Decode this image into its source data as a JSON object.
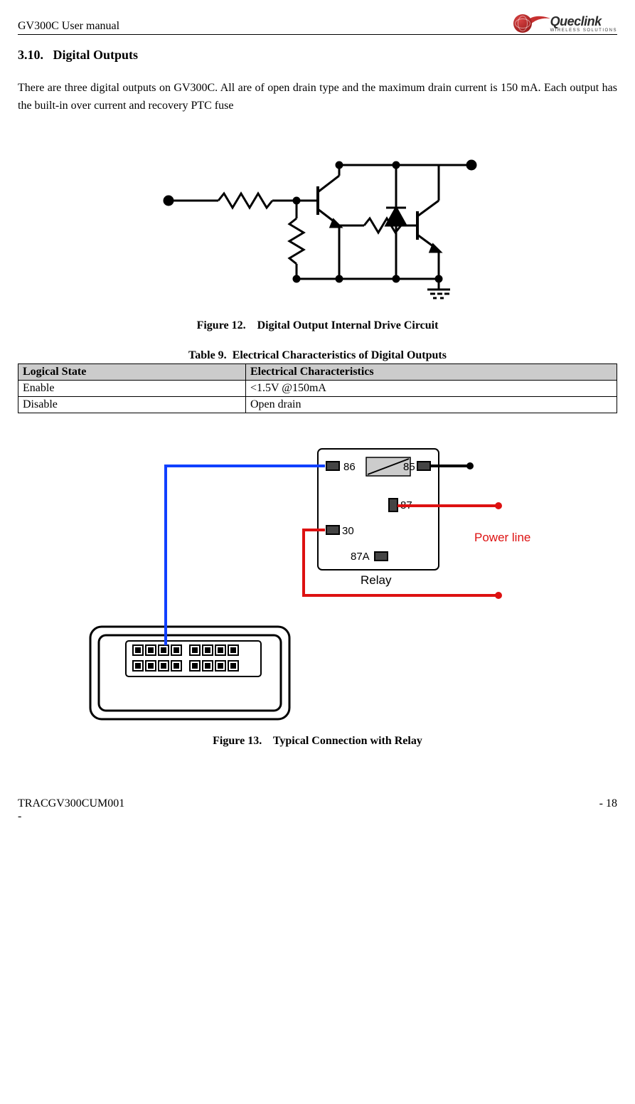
{
  "header": {
    "doc_title": "GV300C User manual",
    "brand": "Queclink",
    "brand_tagline": "WIRELESS SOLUTIONS"
  },
  "section": {
    "number": "3.10.",
    "title": "Digital Outputs"
  },
  "paragraph": "There are three digital outputs on GV300C. All are of open drain type and the maximum drain current is 150 mA. Each output has the built-in over current and recovery PTC fuse",
  "figure12": {
    "label": "Figure 12.",
    "caption": "Digital Output Internal Drive Circuit"
  },
  "table9": {
    "label": "Table 9.",
    "caption": "Electrical Characteristics of Digital Outputs",
    "header_col1": "Logical State",
    "header_col2": "Electrical Characteristics",
    "rows": [
      {
        "state": "Enable",
        "char": "<1.5V @150mA"
      },
      {
        "state": "Disable",
        "char": "Open drain"
      }
    ]
  },
  "relay": {
    "pin86": "86",
    "pin85": "85",
    "pin87": "87",
    "pin30": "30",
    "pin87a": "87A",
    "label": "Relay",
    "power": "Power line"
  },
  "figure13": {
    "label": "Figure 13.",
    "caption": "Typical Connection with Relay"
  },
  "footer": {
    "code": "TRACGV300CUM001",
    "dash": "-",
    "page": "- 18"
  }
}
